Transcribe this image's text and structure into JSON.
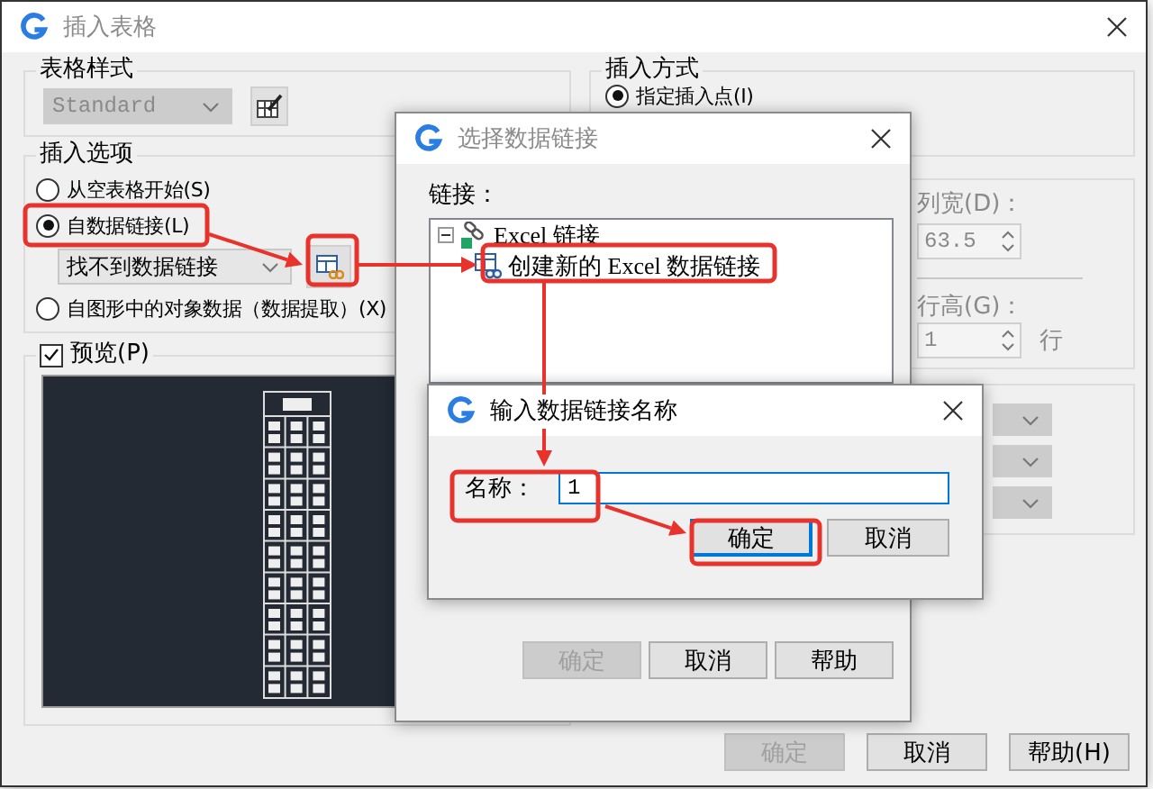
{
  "main_window": {
    "title": "插入表格",
    "active": false,
    "table_style": {
      "label": "表格样式",
      "dropdown": {
        "value": "Standard",
        "disabled": true
      }
    },
    "insert_options": {
      "label": "插入选项",
      "options": [
        {
          "label": "从空表格开始(S)",
          "selected": false
        },
        {
          "label": "自数据链接(L)",
          "selected": true
        },
        {
          "label": "自图形中的对象数据（数据提取）(X)",
          "selected": false
        }
      ],
      "link_dropdown": {
        "value": "找不到数据链接",
        "disabled": false
      }
    },
    "preview": {
      "label": "预览(P)",
      "checked": true
    },
    "insert_method": {
      "label": "插入方式",
      "options": [
        {
          "label": "指定插入点(I)",
          "selected": true
        }
      ]
    },
    "column_width": {
      "label": "列宽(D)：",
      "value": "63.5",
      "disabled": true
    },
    "row_height": {
      "label": "行高(G)：",
      "value": "1",
      "unit": "行",
      "disabled": true
    },
    "cell_style_dropdowns": [
      {
        "disabled": true
      },
      {
        "disabled": true
      },
      {
        "disabled": true
      }
    ],
    "buttons": [
      {
        "label": "确定",
        "disabled": true
      },
      {
        "label": "取消",
        "disabled": false
      },
      {
        "label": "帮助(H)",
        "disabled": false
      }
    ]
  },
  "select_link_dialog": {
    "title": "选择数据链接",
    "active": false,
    "links_label": "链接：",
    "tree": [
      {
        "label": "Excel 链接",
        "expanded": true,
        "children": [
          {
            "label": "创建新的 Excel 数据链接"
          }
        ]
      }
    ],
    "buttons": [
      {
        "label": "确定",
        "disabled": true
      },
      {
        "label": "取消",
        "disabled": false
      },
      {
        "label": "帮助",
        "disabled": false
      }
    ]
  },
  "name_dialog": {
    "title": "输入数据链接名称",
    "active": true,
    "name_field": {
      "label": "名称：",
      "value": "1"
    },
    "buttons": [
      {
        "label": "确定",
        "disabled": false,
        "focused": true
      },
      {
        "label": "取消",
        "disabled": false,
        "focused": false
      }
    ]
  }
}
